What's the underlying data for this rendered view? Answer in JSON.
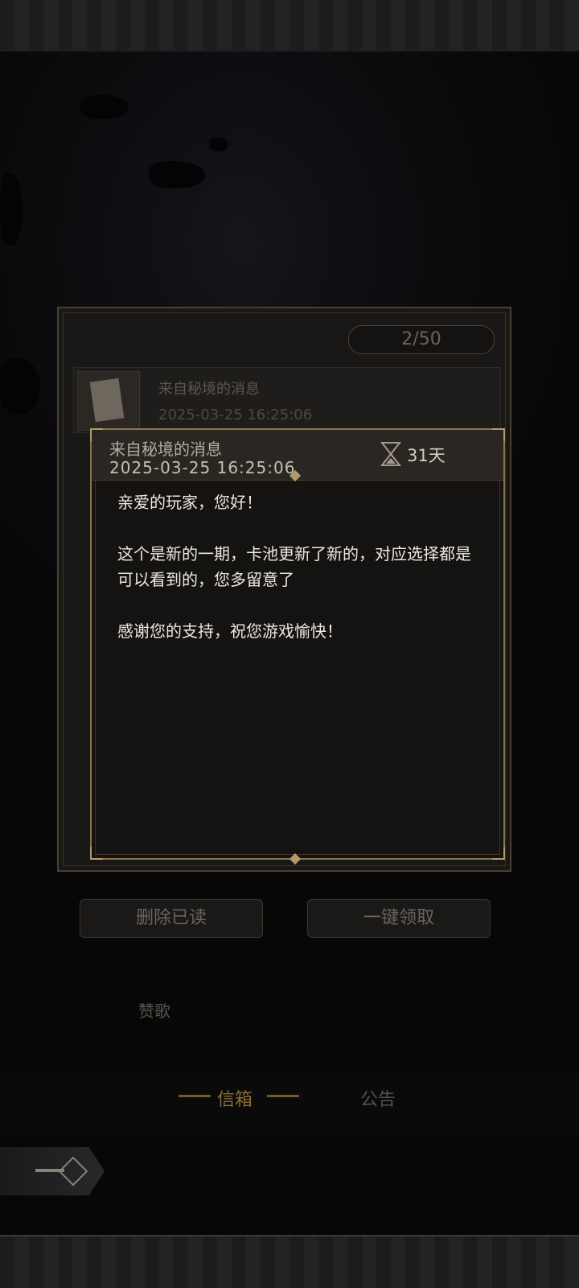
{
  "mail_list": {
    "count": "2/50",
    "item": {
      "title": "来自秘境的消息",
      "date": "2025-03-25 16:25:06"
    }
  },
  "buttons": {
    "delete_read": "删除已读",
    "claim_all": "一键领取"
  },
  "side_labels": {
    "hymn": "赞歌"
  },
  "tabs": {
    "mailbox": "信箱",
    "notice": "公告"
  },
  "mail_detail": {
    "title": "来自秘境的消息",
    "date": "2025-03-25  16:25:06",
    "days_left": "31天",
    "body": [
      "亲爱的玩家，您好！",
      "这个是新的一期，卡池更新了新的，对应选择都是可以看到的，您多留意了",
      "感谢您的支持，祝您游戏愉快！"
    ]
  },
  "icons": {
    "hourglass": "hourglass-icon",
    "back": "back-arrow-icon",
    "mail_thumb": "scroll-letter-icon"
  },
  "colors": {
    "gold_border": "#8a7350",
    "accent_tab": "#8a6d3a",
    "dialog_bg": "#141312",
    "body_text": "#ece8e0"
  }
}
